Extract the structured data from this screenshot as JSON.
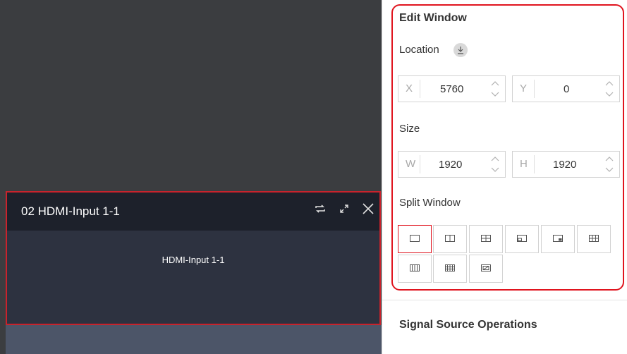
{
  "window": {
    "title": "02  HDMI-Input 1-1",
    "content_label": "HDMI-Input 1-1"
  },
  "edit": {
    "heading": "Edit Window",
    "location_label": "Location",
    "x_prefix": "X",
    "x_value": "5760",
    "y_prefix": "Y",
    "y_value": "0",
    "size_label": "Size",
    "w_prefix": "W",
    "w_value": "1920",
    "h_prefix": "H",
    "h_value": "1920",
    "split_label": "Split Window"
  },
  "signal_heading": "Signal Source Operations",
  "colors": {
    "highlight": "#e0141e",
    "window_border": "#c8232c",
    "titlebar": "#1d212b"
  },
  "icons": [
    "swap-icon",
    "expand-icon",
    "close-icon",
    "download-icon",
    "spinner-arrows-icon",
    "split-1-icon",
    "split-2-icon",
    "split-4-icon",
    "split-pip-left-icon",
    "split-pip-right-icon",
    "split-6-icon",
    "split-3col-icon",
    "split-9-icon",
    "split-custom-icon"
  ]
}
